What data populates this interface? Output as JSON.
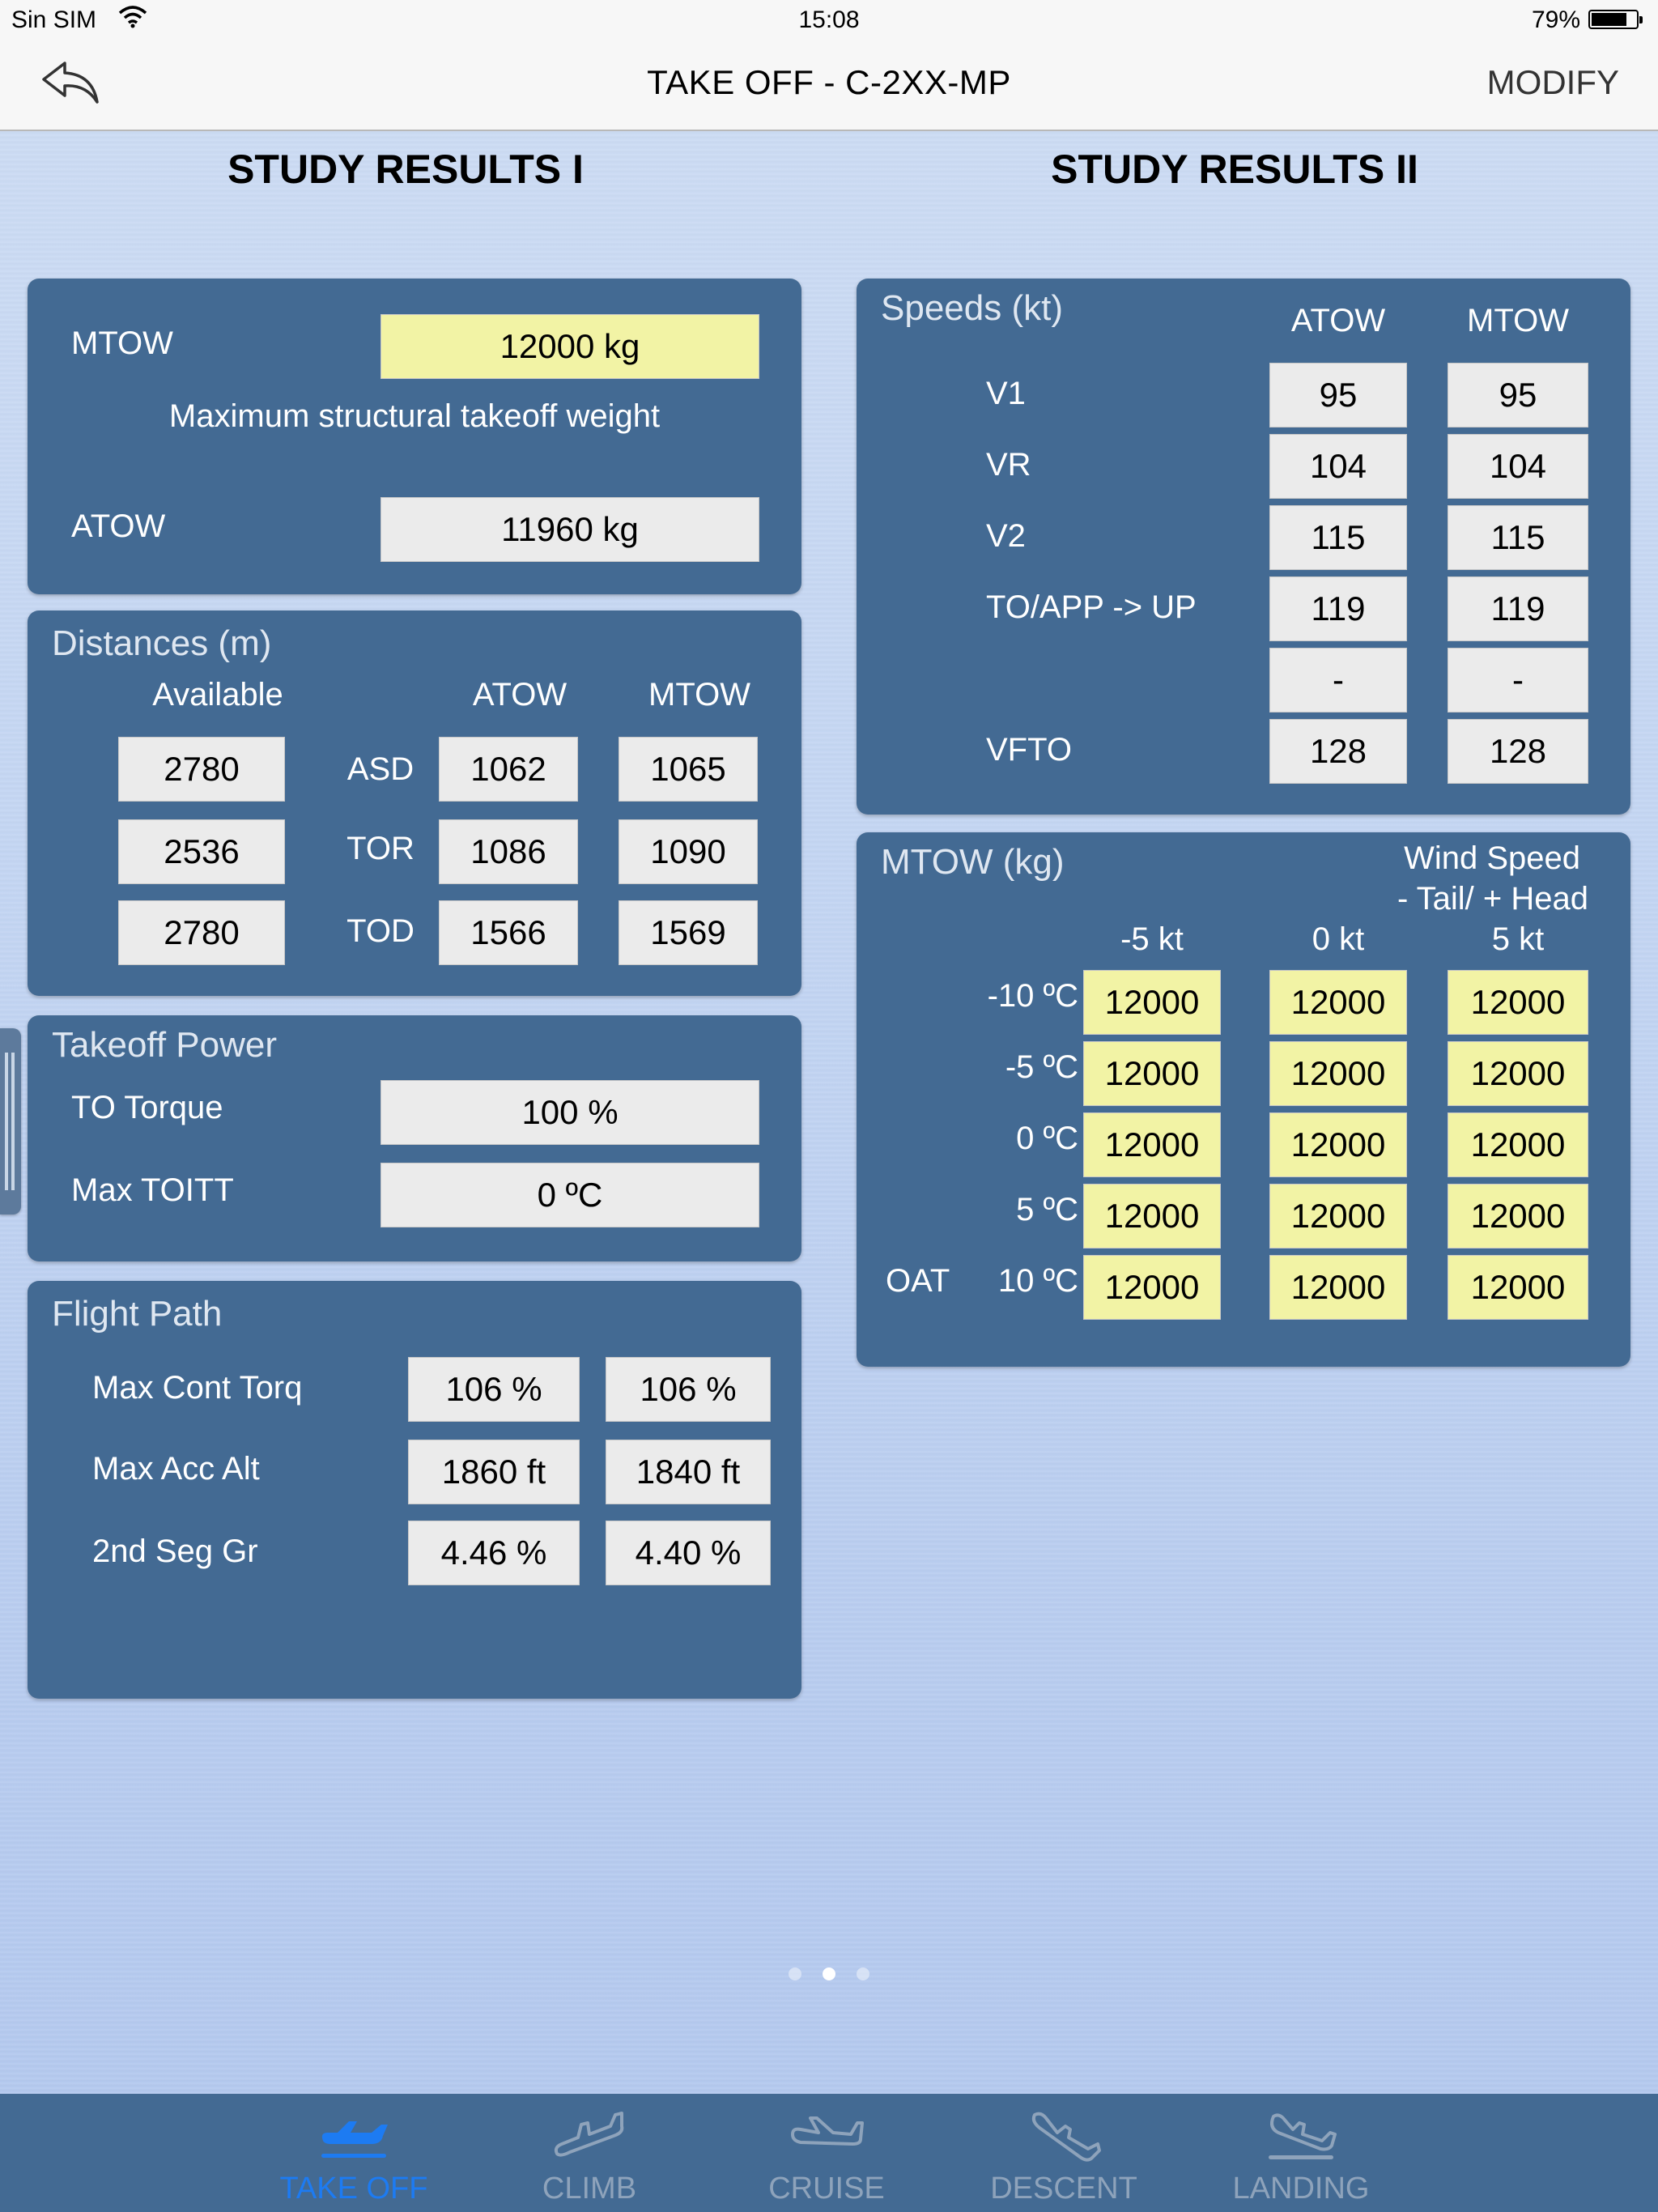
{
  "status_bar": {
    "carrier": "Sin SIM",
    "time": "15:08",
    "battery": "79%",
    "battery_level": 0.79
  },
  "nav": {
    "title": "TAKE OFF - C-2XX-MP",
    "modify_label": "MODIFY"
  },
  "col1_title": "STUDY RESULTS I",
  "col2_title": "STUDY RESULTS II",
  "weights": {
    "mtow_label": "MTOW",
    "mtow_value": "12000 kg",
    "description": "Maximum structural takeoff weight",
    "atow_label": "ATOW",
    "atow_value": "11960 kg"
  },
  "distances": {
    "title": "Distances (m)",
    "headers": {
      "available": "Available",
      "atow": "ATOW",
      "mtow": "MTOW"
    },
    "rows": [
      {
        "available": "2780",
        "label": "ASD",
        "atow": "1062",
        "mtow": "1065"
      },
      {
        "available": "2536",
        "label": "TOR",
        "atow": "1086",
        "mtow": "1090"
      },
      {
        "available": "2780",
        "label": "TOD",
        "atow": "1566",
        "mtow": "1569"
      }
    ]
  },
  "takeoff_power": {
    "title": "Takeoff Power",
    "rows": [
      {
        "label": "TO Torque",
        "value": "100 %"
      },
      {
        "label": "Max TOITT",
        "value": "0 ºC"
      }
    ]
  },
  "flight_path": {
    "title": "Flight Path",
    "rows": [
      {
        "label": "Max Cont Torq",
        "atow": "106 %",
        "mtow": "106 %"
      },
      {
        "label": "Max Acc Alt",
        "atow": "1860 ft",
        "mtow": "1840 ft"
      },
      {
        "label": "2nd Seg Gr",
        "atow": "4.46 %",
        "mtow": "4.40 %"
      }
    ]
  },
  "speeds": {
    "title": "Speeds (kt)",
    "headers": {
      "atow": "ATOW",
      "mtow": "MTOW"
    },
    "rows": [
      {
        "label": "V1",
        "atow": "95",
        "mtow": "95"
      },
      {
        "label": "VR",
        "atow": "104",
        "mtow": "104"
      },
      {
        "label": "V2",
        "atow": "115",
        "mtow": "115"
      },
      {
        "label": "TO/APP -> UP",
        "atow": "119",
        "mtow": "119"
      },
      {
        "label": "",
        "atow": "-",
        "mtow": "-"
      },
      {
        "label": "VFTO",
        "atow": "128",
        "mtow": "128"
      }
    ]
  },
  "mtow_table": {
    "title": "MTOW (kg)",
    "wind_title_1": "Wind Speed",
    "wind_title_2": "- Tail/ + Head",
    "wind_headers": [
      "-5  kt",
      "0  kt",
      "5  kt"
    ],
    "oat_label": "OAT",
    "rows": [
      {
        "temp": "-10 ºC",
        "values": [
          "12000",
          "12000",
          "12000"
        ]
      },
      {
        "temp": "-5 ºC",
        "values": [
          "12000",
          "12000",
          "12000"
        ]
      },
      {
        "temp": "0 ºC",
        "values": [
          "12000",
          "12000",
          "12000"
        ]
      },
      {
        "temp": "5 ºC",
        "values": [
          "12000",
          "12000",
          "12000"
        ]
      },
      {
        "temp": "10 ºC",
        "values": [
          "12000",
          "12000",
          "12000"
        ]
      }
    ]
  },
  "pager": {
    "current": 2,
    "count": 3
  },
  "tabs": [
    {
      "label": "TAKE OFF",
      "icon": "takeoff-icon"
    },
    {
      "label": "CLIMB",
      "icon": "climb-icon"
    },
    {
      "label": "CRUISE",
      "icon": "cruise-icon"
    },
    {
      "label": "DESCENT",
      "icon": "descent-icon"
    },
    {
      "label": "LANDING",
      "icon": "landing-icon"
    }
  ],
  "colors": {
    "panel": "#436a93",
    "value_box": "#ebebeb",
    "highlight_box": "#f2f3a5",
    "tab_active": "#1d7bf2",
    "tab_inactive": "#8ea3bb"
  }
}
